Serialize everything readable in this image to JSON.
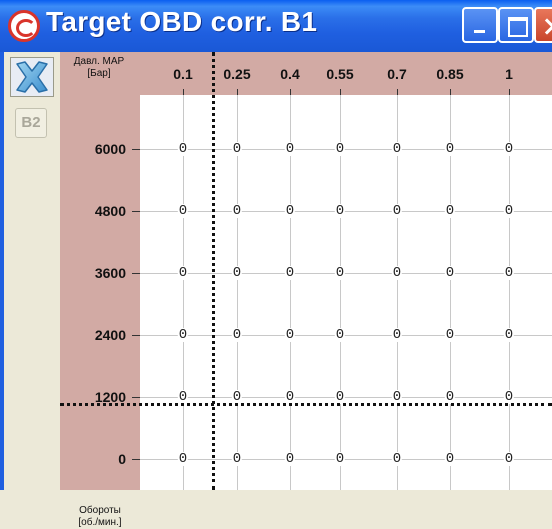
{
  "window": {
    "title": "Target OBD corr. B1"
  },
  "toolbar": {
    "reset_icon": "x-icon",
    "bank_button_label": "B2"
  },
  "table": {
    "corner_label_line1": "Давл. MAP",
    "corner_label_line2": "[Бар]",
    "row_unit_line1": "Обороты",
    "row_unit_line2": "[об./мин.]",
    "columns": [
      "0.1",
      "0.25",
      "0.4",
      "0.55",
      "0.7",
      "0.85",
      "1"
    ],
    "rows": [
      "6000",
      "4800",
      "3600",
      "2400",
      "1200",
      "0"
    ],
    "cells": [
      [
        "0",
        "0",
        "0",
        "0",
        "0",
        "0",
        "0"
      ],
      [
        "0",
        "0",
        "0",
        "0",
        "0",
        "0",
        "0"
      ],
      [
        "0",
        "0",
        "0",
        "0",
        "0",
        "0",
        "0"
      ],
      [
        "0",
        "0",
        "0",
        "0",
        "0",
        "0",
        "0"
      ],
      [
        "0",
        "0",
        "0",
        "0",
        "0",
        "0",
        "0"
      ],
      [
        "0",
        "0",
        "0",
        "0",
        "0",
        "0",
        "0"
      ]
    ],
    "header_color": "#d2aaa4"
  }
}
